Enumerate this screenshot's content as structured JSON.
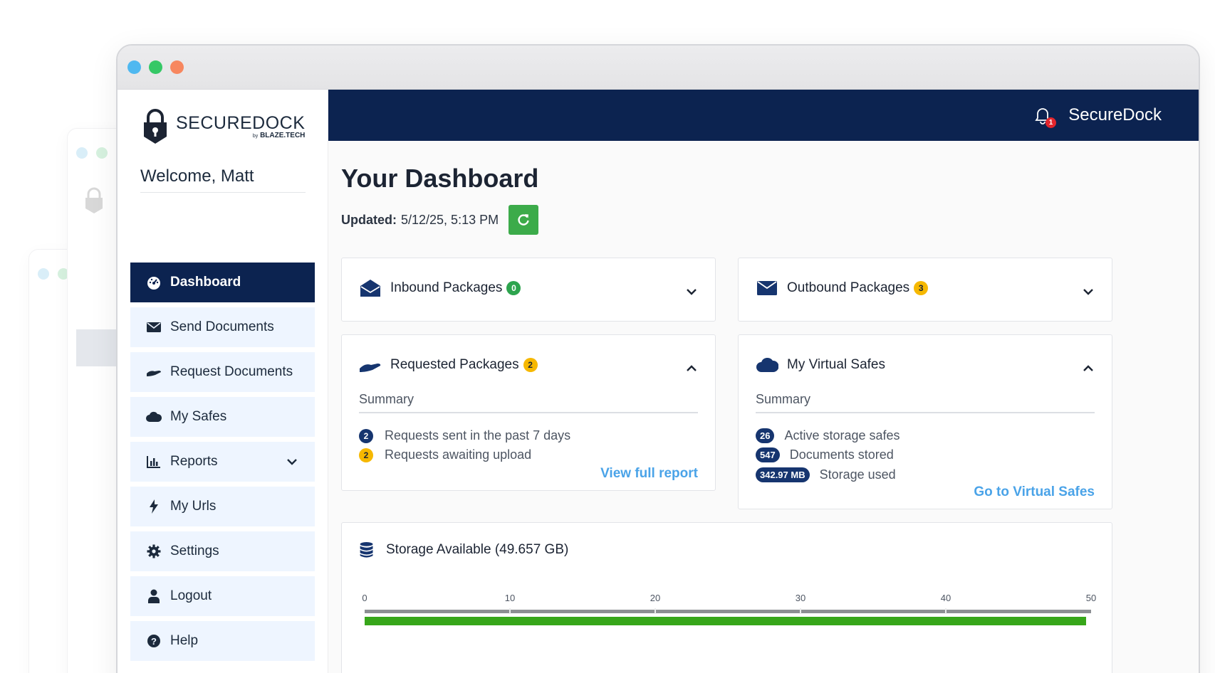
{
  "window": {
    "traffic_colors": [
      "#4fb8f0",
      "#35c866",
      "#f7875f"
    ]
  },
  "sidebar": {
    "brand_name": "SECUREDOCK",
    "brand_sub_by": "by",
    "brand_sub": "BLAZE.TECH",
    "welcome": "Welcome, Matt",
    "items": [
      {
        "label": "Dashboard",
        "icon": "dashboard-gauge-icon",
        "active": true
      },
      {
        "label": "Send Documents",
        "icon": "envelope-icon"
      },
      {
        "label": "Request Documents",
        "icon": "hand-receive-icon"
      },
      {
        "label": "My Safes",
        "icon": "cloud-icon"
      },
      {
        "label": "Reports",
        "icon": "bar-chart-icon",
        "expandable": true
      },
      {
        "label": "My Urls",
        "icon": "bolt-icon"
      },
      {
        "label": "Settings",
        "icon": "gear-icon"
      },
      {
        "label": "Logout",
        "icon": "user-icon"
      },
      {
        "label": "Help",
        "icon": "question-circle-icon"
      }
    ]
  },
  "topbar": {
    "title": "SecureDock",
    "notification_count": "1"
  },
  "dashboard": {
    "title": "Your Dashboard",
    "updated_label": "Updated:",
    "updated_value": "5/12/25, 5:13 PM"
  },
  "inbound": {
    "title": "Inbound Packages",
    "count": "0"
  },
  "outbound": {
    "title": "Outbound Packages",
    "count": "3"
  },
  "requested": {
    "title": "Requested Packages",
    "count": "2",
    "summary_label": "Summary",
    "stats": [
      {
        "value": "2",
        "label": "Requests sent in the past 7 days",
        "color": "#16356f"
      },
      {
        "value": "2",
        "label": "Requests awaiting upload",
        "color": "#f6b800"
      }
    ],
    "link": "View full report"
  },
  "safes": {
    "title": "My Virtual Safes",
    "summary_label": "Summary",
    "stats": [
      {
        "value": "26",
        "label": "Active storage safes"
      },
      {
        "value": "547",
        "label": "Documents stored"
      },
      {
        "value": "342.97 MB",
        "label": "Storage used"
      }
    ],
    "link": "Go to Virtual Safes"
  },
  "storage": {
    "title": "Storage Available (49.657 GB)",
    "axis_ticks": [
      "0",
      "10",
      "20",
      "30",
      "40",
      "50"
    ],
    "axis_max": 50,
    "available_gb": 49.657,
    "bar_color": "#37a61a"
  }
}
